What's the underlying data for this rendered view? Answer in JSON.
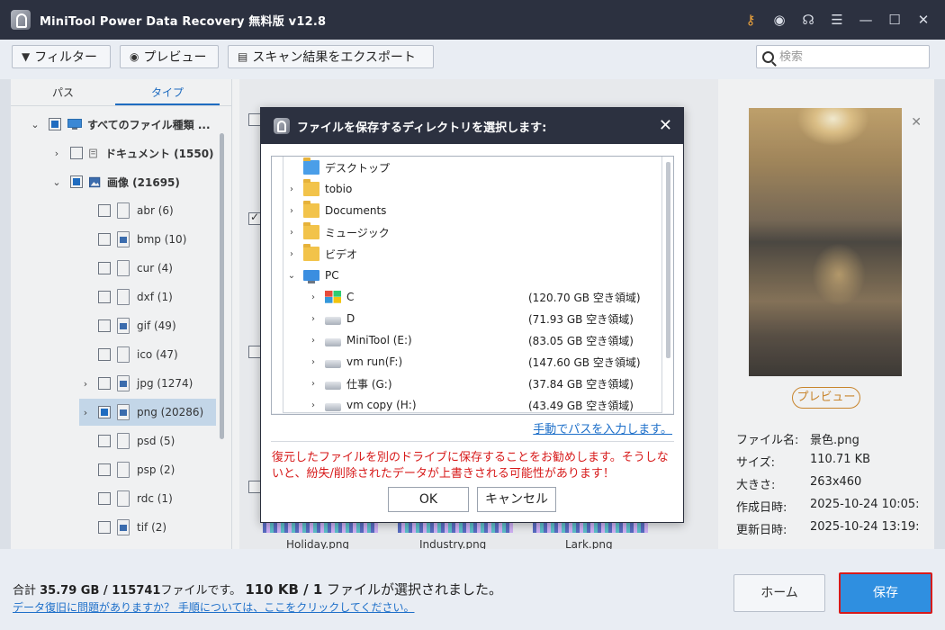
{
  "app": {
    "title": "MiniTool Power Data Recovery 無料版 v12.8",
    "title_icons": [
      "key-icon",
      "disc-icon",
      "headset-icon",
      "menu-icon",
      "minimize-icon",
      "maximize-icon",
      "close-icon"
    ]
  },
  "toolbar": {
    "filter_label": "フィルター",
    "preview_label": "プレビュー",
    "export_label": "スキャン結果をエクスポート",
    "search_placeholder": "検索"
  },
  "left": {
    "tabs": [
      "パス",
      "タイプ"
    ],
    "active_tab": "タイプ",
    "root_label": "すべてのファイル種類 ...",
    "categories": [
      {
        "label": "ドキュメント (1550)",
        "expanded": false
      },
      {
        "label": "画像 (21695)",
        "expanded": true
      }
    ],
    "items": [
      {
        "label": "abr (6)",
        "img": false,
        "expandable": false
      },
      {
        "label": "bmp (10)",
        "img": true,
        "expandable": false
      },
      {
        "label": "cur (4)",
        "img": false,
        "expandable": false
      },
      {
        "label": "dxf (1)",
        "img": false,
        "expandable": false
      },
      {
        "label": "gif (49)",
        "img": true,
        "expandable": false
      },
      {
        "label": "ico (47)",
        "img": false,
        "expandable": false
      },
      {
        "label": "jpg (1274)",
        "img": true,
        "expandable": true
      },
      {
        "label": "png (20286)",
        "img": true,
        "expandable": true,
        "selected": true
      },
      {
        "label": "psd (5)",
        "img": false,
        "expandable": false
      },
      {
        "label": "psp (2)",
        "img": false,
        "expandable": false
      },
      {
        "label": "rdc (1)",
        "img": false,
        "expandable": false
      },
      {
        "label": "tif (2)",
        "img": true,
        "expandable": false
      }
    ]
  },
  "middle": {
    "thumb_labels": [
      "Holiday.png",
      "Industry.png",
      "Lark.png"
    ]
  },
  "preview": {
    "button_label": "プレビュー",
    "meta": [
      {
        "key": "ファイル名:",
        "value": "景色.png"
      },
      {
        "key": "サイズ:",
        "value": "110.71 KB"
      },
      {
        "key": "大きさ:",
        "value": "263x460"
      },
      {
        "key": "作成日時:",
        "value": "2025-10-24 10:05:"
      },
      {
        "key": "更新日時:",
        "value": "2025-10-24 13:19:"
      }
    ]
  },
  "bottom": {
    "summary_prefix": "合計 ",
    "total_size": "35.79 GB",
    "slash1": " / ",
    "total_files": "115741",
    "files_text": "ファイルです。 ",
    "sel_size": "110 KB",
    "slash2": " / ",
    "sel_count": "1",
    "sel_text": " ファイルが選択されました。",
    "help_link": "データ復旧に問題がありますか？ 手順については、ここをクリックしてください。",
    "home_label": "ホーム",
    "save_label": "保存"
  },
  "dialog": {
    "title": "ファイルを保存するディレクトリを選択します:",
    "tree": [
      {
        "label": "デスクトップ",
        "icon": "desktop-folder-icon",
        "level": 0,
        "chevron": ""
      },
      {
        "label": "tobio",
        "icon": "user-folder-icon",
        "level": 0,
        "chevron": "›"
      },
      {
        "label": "Documents",
        "icon": "documents-folder-icon",
        "level": 0,
        "chevron": "›"
      },
      {
        "label": "ミュージック",
        "icon": "music-folder-icon",
        "level": 0,
        "chevron": "›"
      },
      {
        "label": "ビデオ",
        "icon": "video-folder-icon",
        "level": 0,
        "chevron": "›"
      },
      {
        "label": "PC",
        "icon": "pc-icon",
        "level": 0,
        "chevron": "⌄"
      },
      {
        "label": "C",
        "icon": "windows-drive-icon",
        "level": 1,
        "chevron": "›",
        "free": "(120.70 GB 空き領域)"
      },
      {
        "label": "D",
        "icon": "drive-icon",
        "level": 1,
        "chevron": "›",
        "free": "(71.93 GB 空き領域)"
      },
      {
        "label": "MiniTool (E:)",
        "icon": "drive-icon",
        "level": 1,
        "chevron": "›",
        "free": "(83.05 GB 空き領域)"
      },
      {
        "label": "vm run(F:)",
        "icon": "drive-icon",
        "level": 1,
        "chevron": "›",
        "free": "(147.60 GB 空き領域)"
      },
      {
        "label": "仕事 (G:)",
        "icon": "drive-icon",
        "level": 1,
        "chevron": "›",
        "free": "(37.84 GB 空き領域)"
      },
      {
        "label": "vm copy (H:)",
        "icon": "drive-icon",
        "level": 1,
        "chevron": "›",
        "free": "(43.49 GB 空き領域)"
      }
    ],
    "manual_link": "手動でパスを入力します。",
    "warning": "復元したファイルを別のドライブに保存することをお勧めします。そうしないと、紛失/削除されたデータが上書きされる可能性があります！",
    "ok_label": "OK",
    "cancel_label": "キャンセル"
  }
}
